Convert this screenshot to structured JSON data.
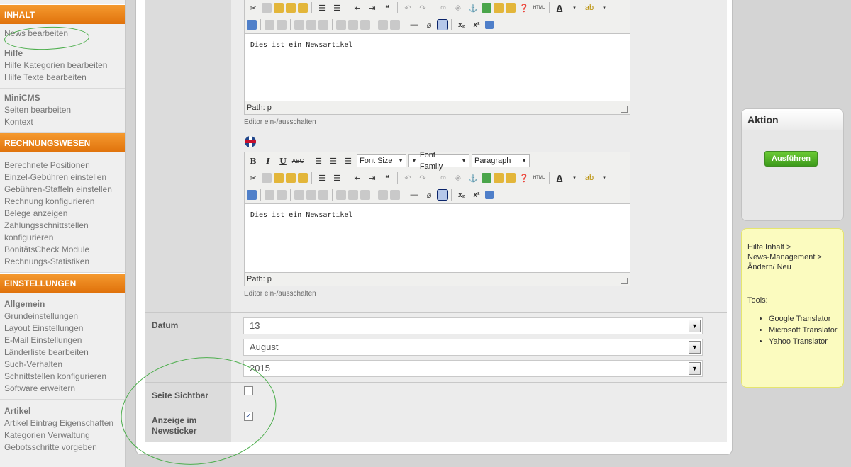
{
  "sidebar": {
    "sections": [
      {
        "header": "INHALT",
        "groups": [
          {
            "title": "",
            "items": [
              "News bearbeiten"
            ]
          },
          {
            "title": "Hilfe",
            "items": [
              "Hilfe Kategorien bearbeiten",
              "Hilfe Texte bearbeiten"
            ]
          },
          {
            "title": "MiniCMS",
            "items": [
              "Seiten bearbeiten",
              "Kontext"
            ]
          }
        ]
      },
      {
        "header": "RECHNUNGSWESEN",
        "groups": [
          {
            "title": "",
            "items": [
              "Berechnete Positionen",
              "Einzel-Gebühren einstellen",
              "Gebühren-Staffeln einstellen",
              "Rechnung konfigurieren",
              "Belege anzeigen",
              "Zahlungsschnittstellen konfigurieren",
              "BonitätsCheck Module",
              "Rechnungs-Statistiken"
            ]
          }
        ]
      },
      {
        "header": "EINSTELLUNGEN",
        "groups": [
          {
            "title": "Allgemein",
            "items": [
              "Grundeinstellungen",
              "Layout Einstellungen",
              "E-Mail Einstellungen",
              "Länderliste bearbeiten",
              "Such-Verhalten",
              "Schnittstellen konfigurieren",
              "Software erweitern"
            ]
          },
          {
            "title": "Artikel",
            "items": [
              "Artikel Eintrag Eigenschaften",
              "Kategorien Verwaltung",
              "Gebotsschritte vorgeben"
            ]
          }
        ]
      }
    ]
  },
  "editor_toolbar": {
    "font_size": "Font Size",
    "font_family": "Font Family",
    "format": "Paragraph",
    "html_label": "HTML"
  },
  "editors": [
    {
      "content": "Dies ist ein Newsartikel",
      "path": "Path: p",
      "toggle": "Editor ein-/ausschalten"
    },
    {
      "content": "Dies ist ein Newsartikel",
      "path": "Path: p",
      "toggle": "Editor ein-/ausschalten"
    }
  ],
  "form": {
    "datum_label": "Datum",
    "day": "13",
    "month": "August",
    "year": "2015",
    "sichtbar_label": "Seite Sichtbar",
    "sichtbar_checked": false,
    "newsticker_label": "Anzeige im Newsticker",
    "newsticker_checked": true
  },
  "aktion": {
    "title": "Aktion",
    "button": "Ausführen"
  },
  "hilfe": {
    "crumb1": "Hilfe Inhalt >",
    "crumb2": "News-Management >",
    "crumb3": "Ändern/ Neu",
    "tools_label": "Tools:",
    "tools": [
      "Google Translator",
      "Microsoft Translator",
      "Yahoo Translator"
    ]
  },
  "colors": {
    "accent_orange": "#ee8a1e",
    "action_green": "#4aa82a",
    "help_yellow": "#fbfbbf",
    "annotation_green": "#4cae4c"
  }
}
